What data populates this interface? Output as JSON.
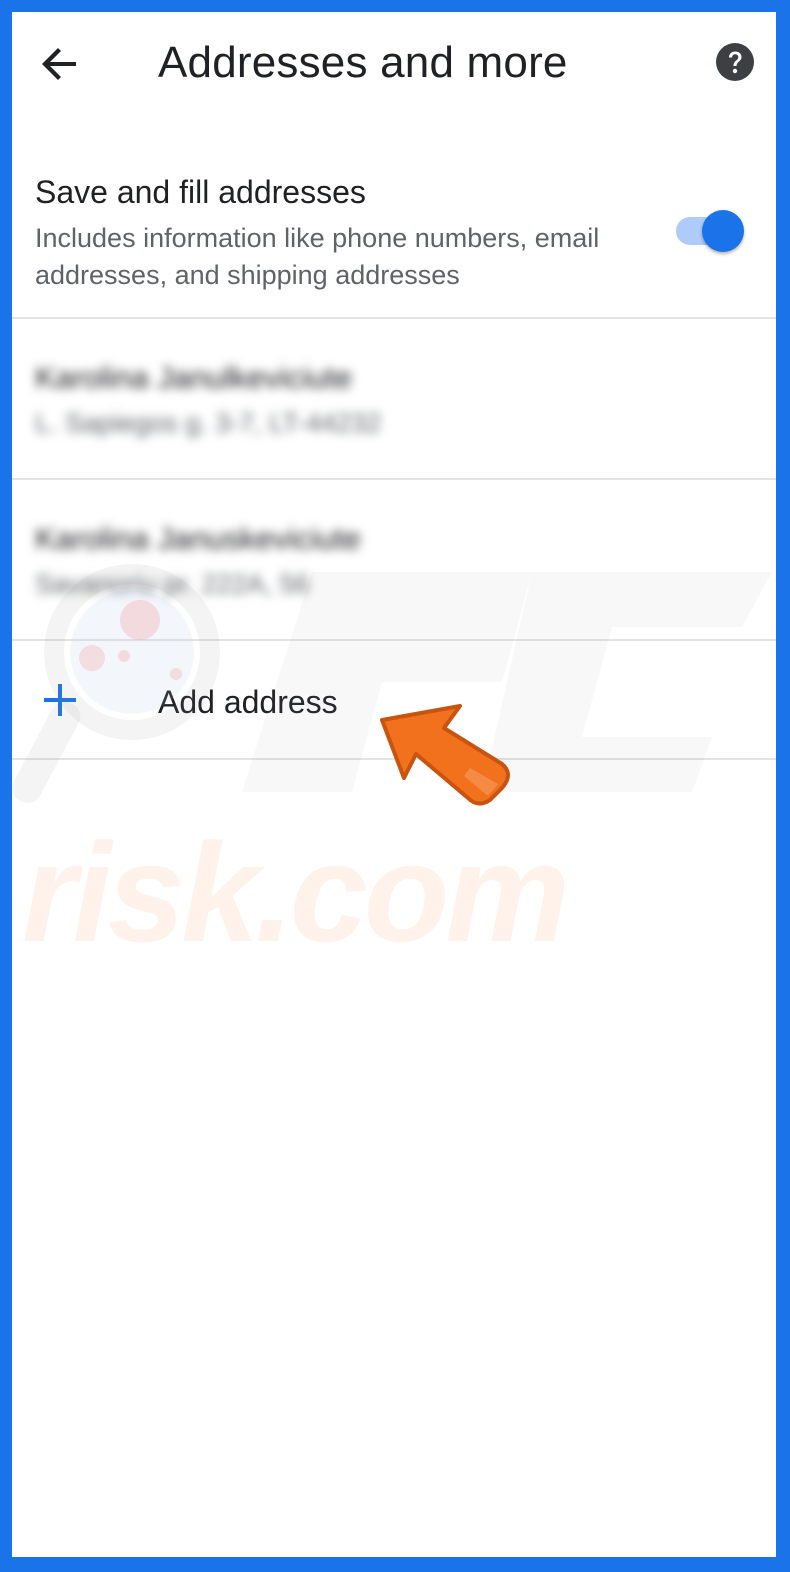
{
  "colors": {
    "accent": "#1a73e8",
    "toggle_track": "#aecbfa",
    "divider": "#e3e3e3",
    "text_primary": "#202124",
    "text_secondary": "#5f6368",
    "arrow": "#f2711c"
  },
  "header": {
    "back_icon": "arrow-left-icon",
    "title": "Addresses and more",
    "help_icon": "help-circle-icon"
  },
  "setting": {
    "title": "Save and fill addresses",
    "description": "Includes information like phone numbers, email addresses, and shipping addresses",
    "toggle_on": true
  },
  "addresses": [
    {
      "name": "Karolina Janulkeviciute",
      "line": "L. Sapiegos g. 3-7, LT-44232"
    },
    {
      "name": "Karolina Januskeviciute",
      "line": "Savanoriu pr. 222A, 56"
    }
  ],
  "add_address": {
    "icon": "plus-icon",
    "label": "Add address"
  },
  "watermark": {
    "text": "risk.com",
    "logo": "PC"
  }
}
